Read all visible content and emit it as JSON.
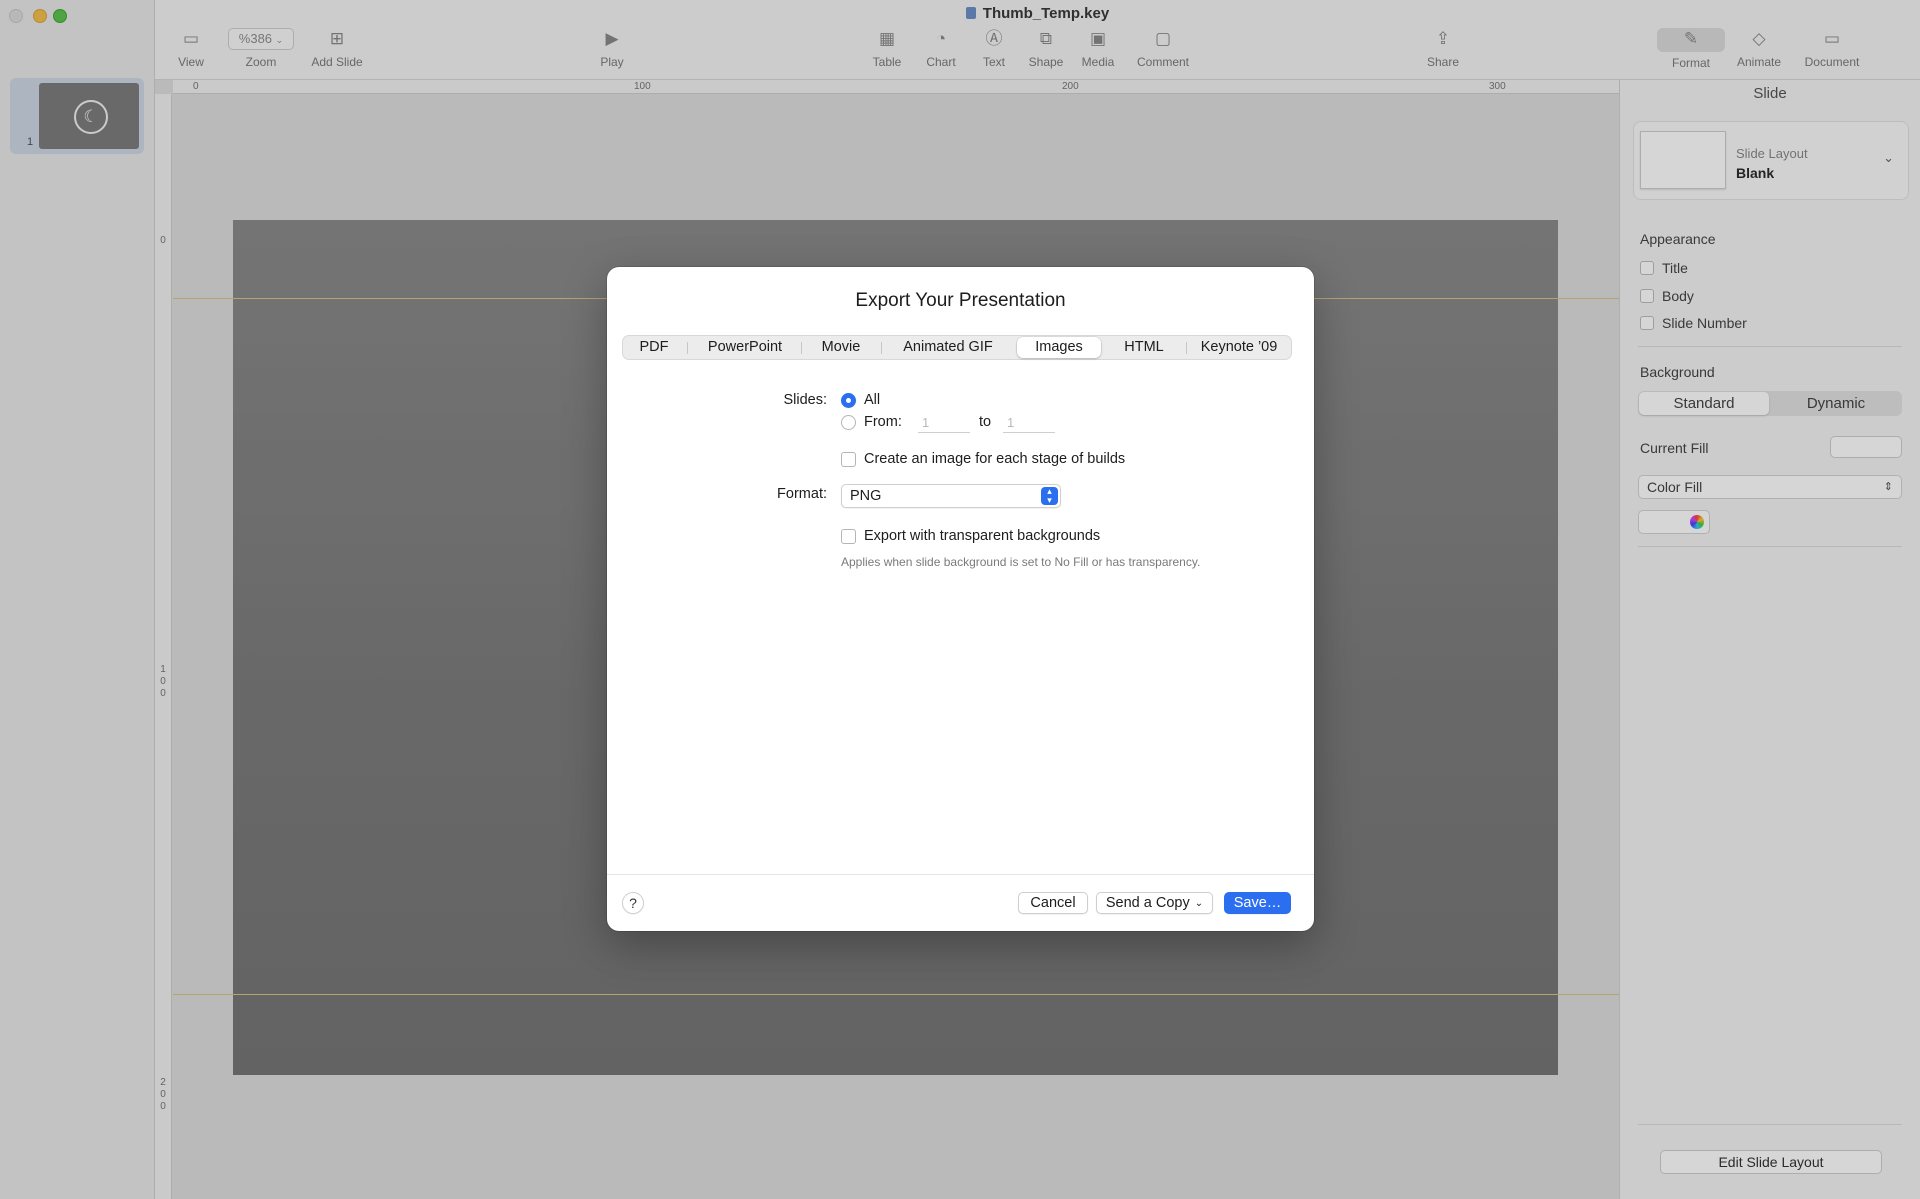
{
  "window": {
    "title": "Thumb_Temp.key"
  },
  "toolbar": {
    "items": [
      {
        "label": "View",
        "icon": "sidebar-icon"
      },
      {
        "label": "Zoom",
        "value": "%386",
        "icon": "chevron-down-icon"
      },
      {
        "label": "Add Slide",
        "icon": "add-slide-icon"
      },
      {
        "label": "Play",
        "icon": "play-icon"
      },
      {
        "label": "Table",
        "icon": "table-icon"
      },
      {
        "label": "Chart",
        "icon": "chart-icon"
      },
      {
        "label": "Text",
        "icon": "text-icon"
      },
      {
        "label": "Shape",
        "icon": "shape-icon"
      },
      {
        "label": "Media",
        "icon": "media-icon"
      },
      {
        "label": "Comment",
        "icon": "comment-icon"
      },
      {
        "label": "Share",
        "icon": "share-icon"
      },
      {
        "label": "Format",
        "icon": "paintbrush-icon"
      },
      {
        "label": "Animate",
        "icon": "diamond-icon"
      },
      {
        "label": "Document",
        "icon": "document-icon"
      }
    ]
  },
  "navigator": {
    "slides": [
      {
        "number": "1"
      }
    ]
  },
  "rulers": {
    "top": [
      "0",
      "100",
      "200",
      "300"
    ],
    "left": [
      "0",
      "1",
      "0",
      "0",
      "2",
      "0",
      "0"
    ]
  },
  "inspector": {
    "title": "Slide",
    "layout_label": "Slide Layout",
    "layout_value": "Blank",
    "appearance_heading": "Appearance",
    "appearance_options": [
      "Title",
      "Body",
      "Slide Number"
    ],
    "background_heading": "Background",
    "background_modes": [
      "Standard",
      "Dynamic"
    ],
    "current_fill_label": "Current Fill",
    "fill_type": "Color Fill",
    "edit_layout_button": "Edit Slide Layout"
  },
  "export_dialog": {
    "title": "Export Your Presentation",
    "tabs": [
      "PDF",
      "PowerPoint",
      "Movie",
      "Animated GIF",
      "Images",
      "HTML",
      "Keynote ’09"
    ],
    "selected_tab": "Images",
    "slides_label": "Slides:",
    "all_label": "All",
    "from_label": "From:",
    "from_value": "1",
    "to_label": "to",
    "to_value": "1",
    "builds_label": "Create an image for each stage of builds",
    "format_label": "Format:",
    "format_value": "PNG",
    "transparent_label": "Export with transparent backgrounds",
    "transparent_hint": "Applies when slide background is set to No Fill or has transparency.",
    "help_label": "?",
    "cancel_label": "Cancel",
    "send_copy_label": "Send a Copy",
    "save_label": "Save…"
  },
  "colors": {
    "accent": "#2b6ef0",
    "slide_background": "#7e7e7e"
  }
}
